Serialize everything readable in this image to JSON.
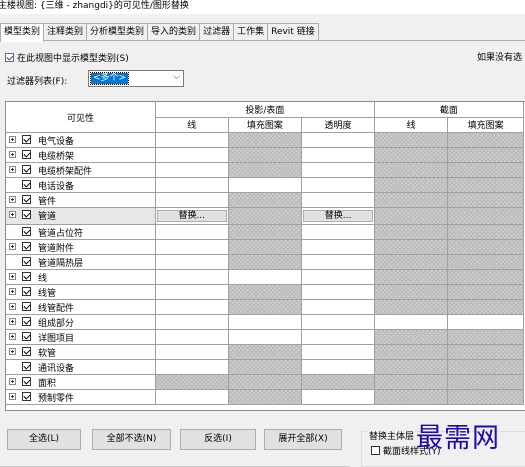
{
  "window": {
    "title": "主楼视图: {三维 - zhangdi}的可见性/图形替换"
  },
  "tabs": [
    "模型类别",
    "注释类别",
    "分析模型类别",
    "导入的类别",
    "过滤器",
    "工作集",
    "Revit 链接"
  ],
  "show_categories": {
    "label": "在此视图中显示模型类别(S)",
    "checked": true
  },
  "if_note": "如果没有选",
  "filter": {
    "label": "过滤器列表(F):",
    "value": "<多个>"
  },
  "headers": {
    "visibility": "可见性",
    "projection_surface": "投影/表面",
    "cut": "截面",
    "lines": "线",
    "fill_pattern": "填充图案",
    "transparency": "透明度",
    "cut_lines": "线",
    "cut_fill": "填充图案"
  },
  "override_label": "替换...",
  "rows": [
    {
      "name": "电气设备",
      "expand": true,
      "checked": true
    },
    {
      "name": "电缆桥架",
      "expand": true,
      "checked": true
    },
    {
      "name": "电缆桥架配件",
      "expand": true,
      "checked": true
    },
    {
      "name": "电话设备",
      "expand": false,
      "checked": true
    },
    {
      "name": "管件",
      "expand": true,
      "checked": true
    },
    {
      "name": "管道",
      "expand": true,
      "checked": true,
      "selected": true
    },
    {
      "name": "管道占位符",
      "expand": false,
      "checked": true
    },
    {
      "name": "管道附件",
      "expand": true,
      "checked": true
    },
    {
      "name": "管道隔热层",
      "expand": false,
      "checked": true
    },
    {
      "name": "线",
      "expand": true,
      "checked": true
    },
    {
      "name": "线管",
      "expand": true,
      "checked": true
    },
    {
      "name": "线管配件",
      "expand": true,
      "checked": true
    },
    {
      "name": "组成部分",
      "expand": true,
      "checked": true
    },
    {
      "name": "详图项目",
      "expand": true,
      "checked": true
    },
    {
      "name": "软管",
      "expand": true,
      "checked": true
    },
    {
      "name": "通讯设备",
      "expand": false,
      "checked": true
    },
    {
      "name": "面积",
      "expand": true,
      "checked": true
    },
    {
      "name": "预制零件",
      "expand": true,
      "checked": true
    }
  ],
  "buttons": {
    "select_all": "全选(L)",
    "select_none": "全部不选(N)",
    "invert": "反选(I)",
    "expand_all": "展开全部(X)"
  },
  "host_group": {
    "legend": "替换主体层",
    "cut_lines": "截面线样式(Y)",
    "cut_lines_checked": false
  },
  "watermark": "最需网"
}
